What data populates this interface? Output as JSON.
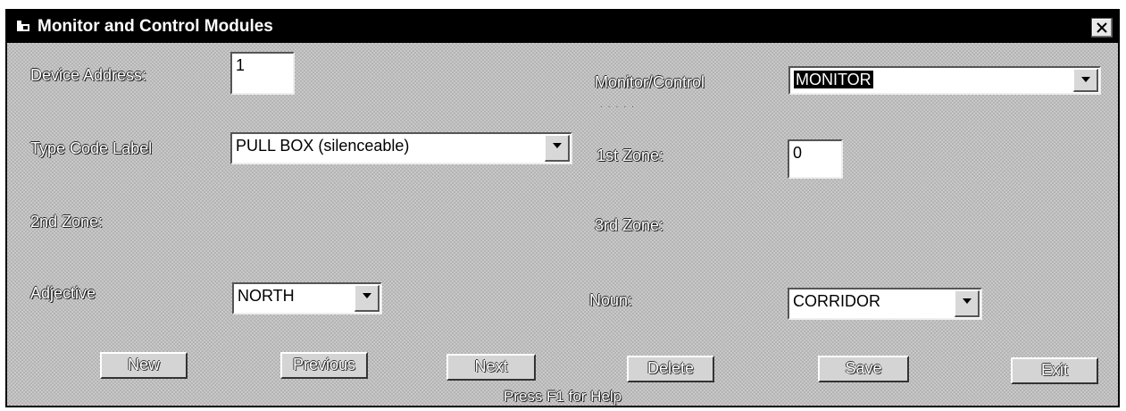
{
  "window": {
    "title": "Monitor and Control Modules",
    "icon": "app-icon",
    "close_icon": "close-icon"
  },
  "form": {
    "device_address": {
      "label": "Device Address:",
      "value": "1"
    },
    "monitor_control": {
      "label": "Monitor/Control",
      "value": "MONITOR"
    },
    "type_code_label": {
      "label": "Type Code Label",
      "value": "PULL BOX (silenceable)"
    },
    "first_zone": {
      "label": "1st Zone:",
      "value": "0"
    },
    "second_zone": {
      "label": "2nd Zone:"
    },
    "third_zone": {
      "label": "3rd Zone:"
    },
    "adjective": {
      "label": "Adjective",
      "value": "NORTH"
    },
    "noun": {
      "label": "Noun:",
      "value": "CORRIDOR"
    }
  },
  "buttons": {
    "new": "New",
    "previous": "Previous",
    "next": "Next",
    "delete": "Delete",
    "save": "Save",
    "exit": "Exit"
  },
  "status": {
    "help": "Press F1 for Help"
  }
}
